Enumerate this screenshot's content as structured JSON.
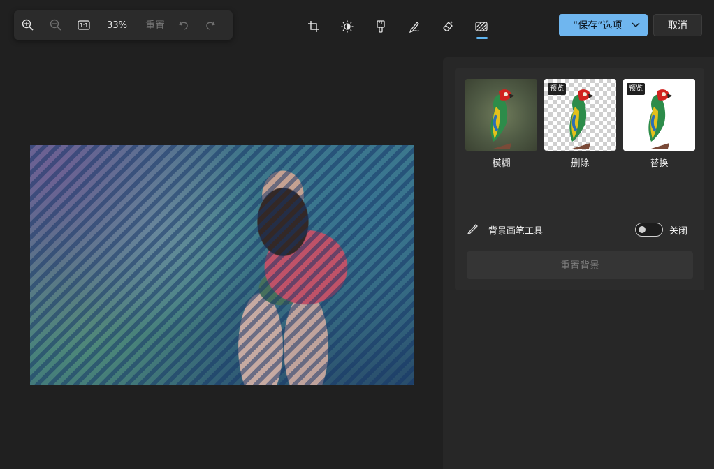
{
  "toolbar": {
    "zoom_in_icon": "zoom-in-icon",
    "zoom_out_icon": "zoom-out-icon",
    "actual_size_label": "1:1",
    "zoom_level": "33%",
    "reset_label": "重置",
    "undo_icon": "undo-icon",
    "redo_icon": "redo-icon"
  },
  "edit_tools": [
    {
      "name": "crop-icon"
    },
    {
      "name": "adjust-icon"
    },
    {
      "name": "filter-icon"
    },
    {
      "name": "markup-icon"
    },
    {
      "name": "erase-icon"
    },
    {
      "name": "background-icon",
      "active": true
    }
  ],
  "actions": {
    "save_label": "“保存”选项",
    "cancel_label": "取消"
  },
  "background_panel": {
    "options": [
      {
        "label": "模糊"
      },
      {
        "label": "删除",
        "badge": "预览"
      },
      {
        "label": "替换",
        "badge": "预览"
      }
    ],
    "brush_tool_label": "背景画笔工具",
    "brush_toggle_state": "关闭",
    "reset_background_label": "重置背景"
  },
  "colors": {
    "accent": "#6fb6ef",
    "panel": "#272727",
    "background": "#202020"
  }
}
